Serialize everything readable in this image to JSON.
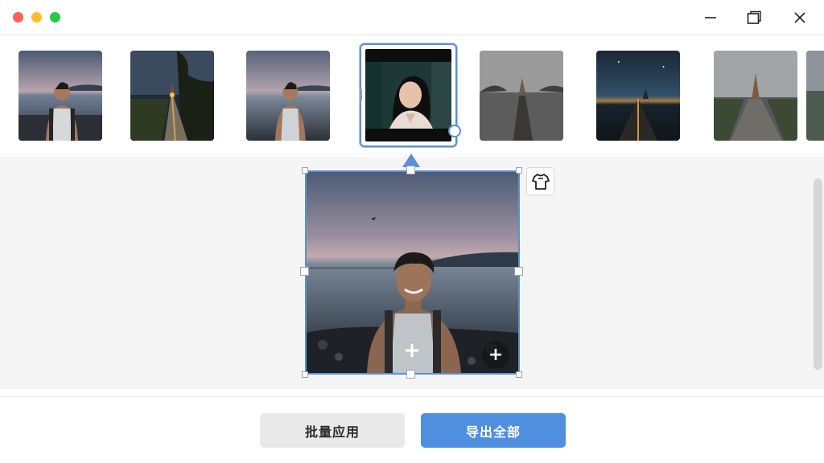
{
  "window": {
    "controls": [
      "close-dot",
      "minimize-dot",
      "zoom-dot"
    ],
    "actions": [
      "minimize-icon",
      "restore-icon",
      "close-icon"
    ]
  },
  "filmstrip": {
    "thumbnails": [
      {
        "name": "thumb-lake-man-1",
        "subject": "man-by-lake"
      },
      {
        "name": "thumb-road-castle-1",
        "subject": "road-to-castle"
      },
      {
        "name": "thumb-lake-man-2",
        "subject": "man-by-lake"
      },
      {
        "name": "thumb-woman-portrait",
        "subject": "woman-portrait",
        "selected": true
      },
      {
        "name": "thumb-castle-pier",
        "subject": "castle-pier"
      },
      {
        "name": "thumb-night-path",
        "subject": "night-path"
      },
      {
        "name": "thumb-cobble-castle",
        "subject": "cobblestone-castle"
      }
    ]
  },
  "editor": {
    "subject": "man-by-lake",
    "overlay_icons": [
      "plus-icon",
      "add-circle-icon"
    ],
    "side_tool_icon": "shirt-icon"
  },
  "footer": {
    "batch_label": "批量应用",
    "export_label": "导出全部"
  },
  "colors": {
    "accent": "#5b8fd9",
    "export_button": "#4f8fe0",
    "batch_button": "#e9e9e9"
  }
}
